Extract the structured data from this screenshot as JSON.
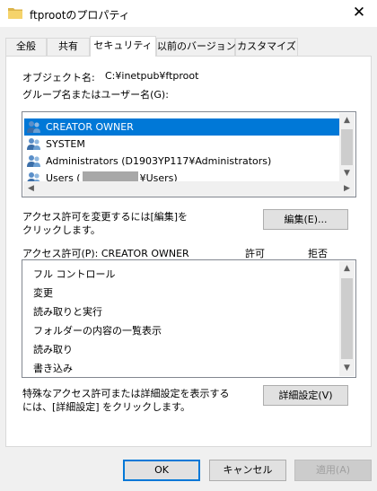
{
  "window": {
    "title": "ftprootのプロパティ",
    "close_glyph": "✕"
  },
  "tabs": [
    {
      "label": "全般"
    },
    {
      "label": "共有"
    },
    {
      "label": "セキュリティ",
      "active": true
    },
    {
      "label": "以前のバージョン"
    },
    {
      "label": "カスタマイズ"
    }
  ],
  "security": {
    "object_name_label": "オブジェクト名:",
    "object_name_value": "C:¥inetpub¥ftproot",
    "group_list_label": "グループ名またはユーザー名(G):",
    "principals": [
      {
        "name": "CREATOR OWNER",
        "selected": true,
        "icon": "users-icon"
      },
      {
        "name": "SYSTEM",
        "icon": "users-icon"
      },
      {
        "name": "Administrators (D1903YP117¥Administrators)",
        "icon": "users-icon"
      },
      {
        "name_prefix": "Users (",
        "name_suffix": "¥Users)",
        "icon": "users-icon"
      }
    ],
    "change_instruction_line1": "アクセス許可を変更するには[編集]を",
    "change_instruction_line2": "クリックします。",
    "edit_button": "編集(E)...",
    "permissions_header": "アクセス許可(P): CREATOR OWNER",
    "allow_header": "許可",
    "deny_header": "拒否",
    "permissions": [
      {
        "name": "フル コントロール"
      },
      {
        "name": "変更"
      },
      {
        "name": "読み取りと実行"
      },
      {
        "name": "フォルダーの内容の一覧表示"
      },
      {
        "name": "読み取り"
      },
      {
        "name": "書き込み"
      }
    ],
    "advanced_instruction_line1": "特殊なアクセス許可または詳細設定を表示する",
    "advanced_instruction_line2": "には、[詳細設定] をクリックします。",
    "advanced_button": "詳細設定(V)"
  },
  "footer": {
    "ok_button": "OK",
    "cancel_button": "キャンセル",
    "apply_button": "適用(A)"
  },
  "colors": {
    "selection": "#0078d7",
    "window_bg": "#f0f0f0",
    "panel_bg": "#ffffff"
  }
}
